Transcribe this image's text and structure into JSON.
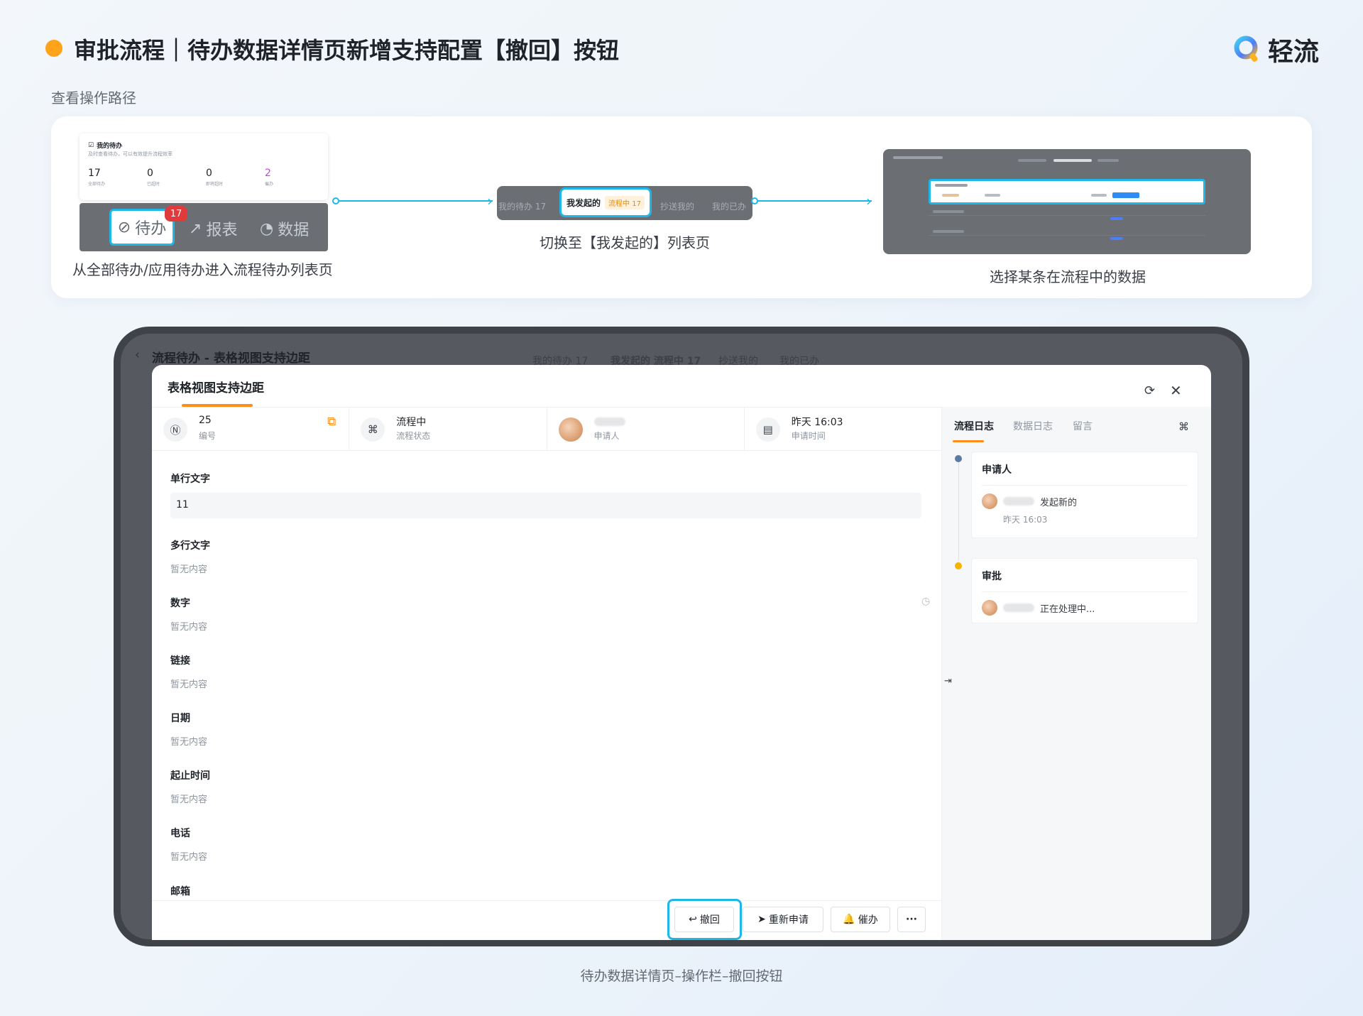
{
  "header": {
    "title": "审批流程｜待办数据详情页新增支持配置【撤回】按钮",
    "brand": "轻流",
    "subtitle": "查看操作路径",
    "accent": "#ffa31a"
  },
  "path": {
    "step1": {
      "card_title": "我的待办",
      "card_sub": "及时查看待办，可以有效提升流程效率",
      "stats": [
        {
          "value": "17",
          "label": "全部待办"
        },
        {
          "value": "0",
          "label": "已超时"
        },
        {
          "value": "0",
          "label": "即将超时"
        },
        {
          "value": "2",
          "label": "催办"
        }
      ],
      "tabs": [
        "待办",
        "报表",
        "数据"
      ],
      "badge": "17",
      "caption": "从全部待办/应用待办进入流程待办列表页"
    },
    "step2": {
      "tabs": [
        "我的待办 17",
        "抄送我的",
        "我的已办"
      ],
      "active_label": "我发起的",
      "active_tag": "流程中 17",
      "caption": "切换至【我发起的】列表页"
    },
    "step3": {
      "caption": "选择某条在流程中的数据"
    },
    "line_color": "#1fb6e8"
  },
  "background_page": {
    "title": "流程待办 - 表格视图支持边距",
    "tabs": [
      "我的待办 17",
      "我发起的 流程中 17",
      "抄送我的",
      "我的已办"
    ]
  },
  "detail": {
    "title": "表格视图支持边距",
    "info": [
      {
        "value": "25",
        "label": "编号",
        "icon": "number-icon"
      },
      {
        "value": "流程中",
        "label": "流程状态",
        "icon": "flow-icon"
      },
      {
        "value": "",
        "label": "申请人",
        "icon": "avatar"
      },
      {
        "value": "昨天 16:03",
        "label": "申请时间",
        "icon": "calendar-icon"
      }
    ],
    "fields": [
      {
        "label": "单行文字",
        "value": "11"
      },
      {
        "label": "多行文字",
        "value": "暂无内容"
      },
      {
        "label": "数字",
        "value": "暂无内容"
      },
      {
        "label": "链接",
        "value": "暂无内容"
      },
      {
        "label": "日期",
        "value": "暂无内容"
      },
      {
        "label": "起止时间",
        "value": "暂无内容"
      },
      {
        "label": "电话",
        "value": "暂无内容"
      },
      {
        "label": "邮箱",
        "value": ""
      }
    ],
    "side_tabs": [
      "流程日志",
      "数据日志",
      "留言"
    ],
    "logs": [
      {
        "title": "申请人",
        "action": "发起新的",
        "time": "昨天 16:03",
        "dot_color": "#5b7aa3"
      },
      {
        "title": "审批",
        "action": "正在处理中...",
        "time": "",
        "dot_color": "#f5b300"
      }
    ],
    "actions": {
      "withdraw": "撤回",
      "reapply": "重新申请",
      "urge": "催办",
      "more": "···"
    }
  },
  "bottom_caption": "待办数据详情页–操作栏–撤回按钮"
}
